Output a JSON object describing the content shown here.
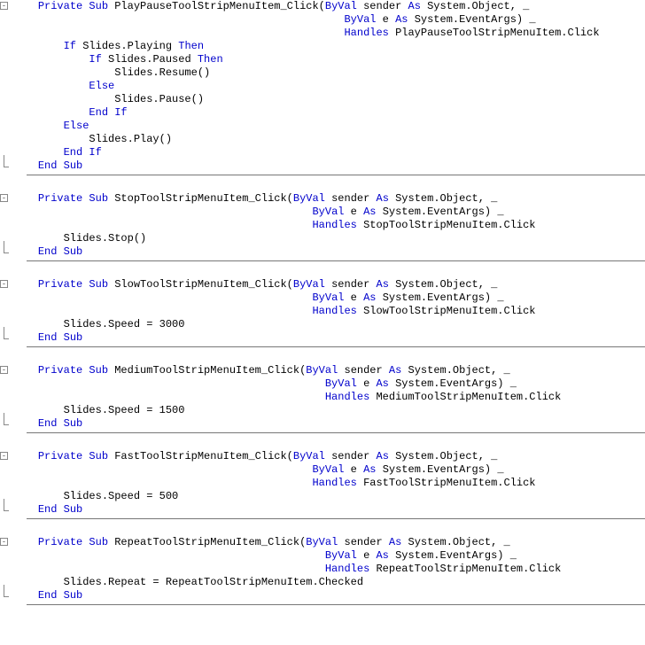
{
  "chart_data": null,
  "code": {
    "methods": [
      {
        "name": "PlayPauseToolStripMenuItem_Click",
        "sig1_pre": "    Private Sub ",
        "sig1_post": "(ByVal sender As System.Object, _",
        "sig2": "                                                    ByVal e As System.EventArgs) _",
        "sig3_pre": "                                                    Handles ",
        "sig3_post": "PlayPauseToolStripMenuItem.Click",
        "body": [
          {
            "indent": "        ",
            "parts": [
              {
                "t": "If ",
                "c": "kw"
              },
              {
                "t": "Slides.Playing ",
                "c": "id"
              },
              {
                "t": "Then",
                "c": "kw"
              }
            ]
          },
          {
            "indent": "            ",
            "parts": [
              {
                "t": "If ",
                "c": "kw"
              },
              {
                "t": "Slides.Paused ",
                "c": "id"
              },
              {
                "t": "Then",
                "c": "kw"
              }
            ]
          },
          {
            "indent": "                ",
            "parts": [
              {
                "t": "Slides.Resume()",
                "c": "id"
              }
            ]
          },
          {
            "indent": "            ",
            "parts": [
              {
                "t": "Else",
                "c": "kw"
              }
            ]
          },
          {
            "indent": "                ",
            "parts": [
              {
                "t": "Slides.Pause()",
                "c": "id"
              }
            ]
          },
          {
            "indent": "            ",
            "parts": [
              {
                "t": "End If",
                "c": "kw"
              }
            ]
          },
          {
            "indent": "        ",
            "parts": [
              {
                "t": "Else",
                "c": "kw"
              }
            ]
          },
          {
            "indent": "            ",
            "parts": [
              {
                "t": "Slides.Play()",
                "c": "id"
              }
            ]
          },
          {
            "indent": "        ",
            "parts": [
              {
                "t": "End If",
                "c": "kw"
              }
            ]
          }
        ],
        "end": "    End Sub"
      },
      {
        "name": "StopToolStripMenuItem_Click",
        "sig1_pre": "    Private Sub ",
        "sig1_post": "(ByVal sender As System.Object, _",
        "sig2": "                                               ByVal e As System.EventArgs) _",
        "sig3_pre": "                                               Handles ",
        "sig3_post": "StopToolStripMenuItem.Click",
        "body": [
          {
            "indent": "        ",
            "parts": [
              {
                "t": "Slides.Stop()",
                "c": "id"
              }
            ]
          }
        ],
        "end": "    End Sub"
      },
      {
        "name": "SlowToolStripMenuItem_Click",
        "sig1_pre": "    Private Sub ",
        "sig1_post": "(ByVal sender As System.Object, _",
        "sig2": "                                               ByVal e As System.EventArgs) _",
        "sig3_pre": "                                               Handles ",
        "sig3_post": "SlowToolStripMenuItem.Click",
        "body": [
          {
            "indent": "        ",
            "parts": [
              {
                "t": "Slides.Speed = 3000",
                "c": "id"
              }
            ]
          }
        ],
        "end": "    End Sub"
      },
      {
        "name": "MediumToolStripMenuItem_Click",
        "sig1_pre": "    Private Sub ",
        "sig1_post": "(ByVal sender As System.Object, _",
        "sig2": "                                                 ByVal e As System.EventArgs) _",
        "sig3_pre": "                                                 Handles ",
        "sig3_post": "MediumToolStripMenuItem.Click",
        "body": [
          {
            "indent": "        ",
            "parts": [
              {
                "t": "Slides.Speed = 1500",
                "c": "id"
              }
            ]
          }
        ],
        "end": "    End Sub"
      },
      {
        "name": "FastToolStripMenuItem_Click",
        "sig1_pre": "    Private Sub ",
        "sig1_post": "(ByVal sender As System.Object, _",
        "sig2": "                                               ByVal e As System.EventArgs) _",
        "sig3_pre": "                                               Handles ",
        "sig3_post": "FastToolStripMenuItem.Click",
        "body": [
          {
            "indent": "        ",
            "parts": [
              {
                "t": "Slides.Speed = 500",
                "c": "id"
              }
            ]
          }
        ],
        "end": "    End Sub"
      },
      {
        "name": "RepeatToolStripMenuItem_Click",
        "sig1_pre": "    Private Sub ",
        "sig1_post": "(ByVal sender As System.Object, _",
        "sig2": "                                                 ByVal e As System.EventArgs) _",
        "sig3_pre": "                                                 Handles ",
        "sig3_post": "RepeatToolStripMenuItem.Click",
        "body": [
          {
            "indent": "        ",
            "parts": [
              {
                "t": "Slides.Repeat = RepeatToolStripMenuItem.Checked",
                "c": "id"
              }
            ]
          }
        ],
        "end": "    End Sub"
      }
    ]
  }
}
